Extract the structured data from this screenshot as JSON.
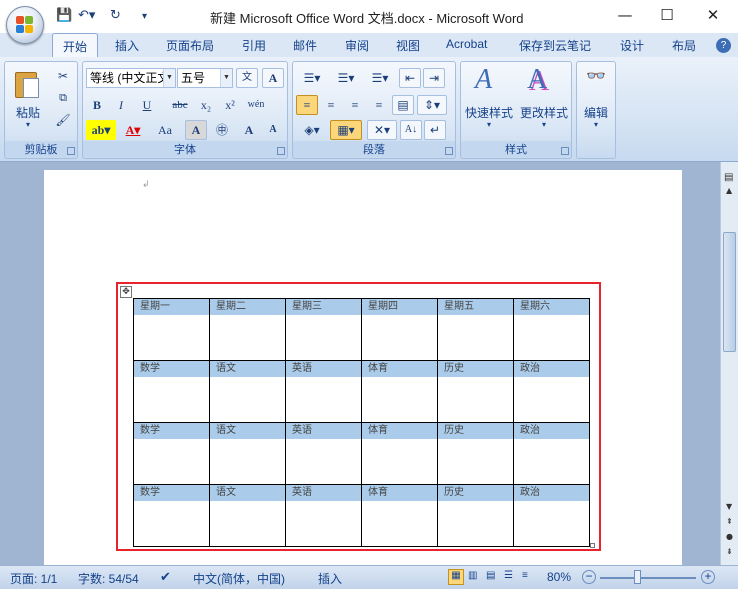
{
  "window": {
    "title": "新建 Microsoft Office Word 文档.docx - Microsoft Word"
  },
  "tabs": [
    {
      "label": "开始",
      "active": true
    },
    {
      "label": "插入"
    },
    {
      "label": "页面布局"
    },
    {
      "label": "引用"
    },
    {
      "label": "邮件"
    },
    {
      "label": "审阅"
    },
    {
      "label": "视图"
    },
    {
      "label": "Acrobat"
    },
    {
      "label": "保存到云笔记"
    },
    {
      "label": "设计"
    },
    {
      "label": "布局"
    }
  ],
  "ribbon": {
    "clipboard": {
      "label": "剪贴板",
      "paste": "粘贴"
    },
    "font": {
      "label": "字体",
      "font_name": "等线 (中文正文",
      "font_size": "五号",
      "bold": "B",
      "italic": "I",
      "underline": "U",
      "strike": "abc",
      "subscript": "x₂",
      "superscript": "x²",
      "change_case": "Aa",
      "char_border": "A",
      "grow": "A",
      "shrink": "A",
      "wen": "文",
      "pinyin": "wén"
    },
    "paragraph": {
      "label": "段落"
    },
    "styles": {
      "label": "样式",
      "quick": "快速样式",
      "change": "更改样式"
    },
    "editing": {
      "label": "编辑"
    }
  },
  "table": {
    "rows": [
      [
        "星期一",
        "星期二",
        "星期三",
        "星期四",
        "星期五",
        "星期六"
      ],
      [
        "数学",
        "语文",
        "英语",
        "体育",
        "历史",
        "政治"
      ],
      [
        "数学",
        "语文",
        "英语",
        "体育",
        "历史",
        "政治"
      ],
      [
        "数学",
        "语文",
        "英语",
        "体育",
        "历史",
        "政治"
      ]
    ]
  },
  "status": {
    "page": "页面: 1/1",
    "words": "字数: 54/54",
    "language": "中文(简体，中国)",
    "mode": "插入",
    "zoom": "80%"
  },
  "colors": {
    "highlight_row": "#aacbe9",
    "selection_border": "#e8232b",
    "ribbon_text": "#15428b"
  }
}
